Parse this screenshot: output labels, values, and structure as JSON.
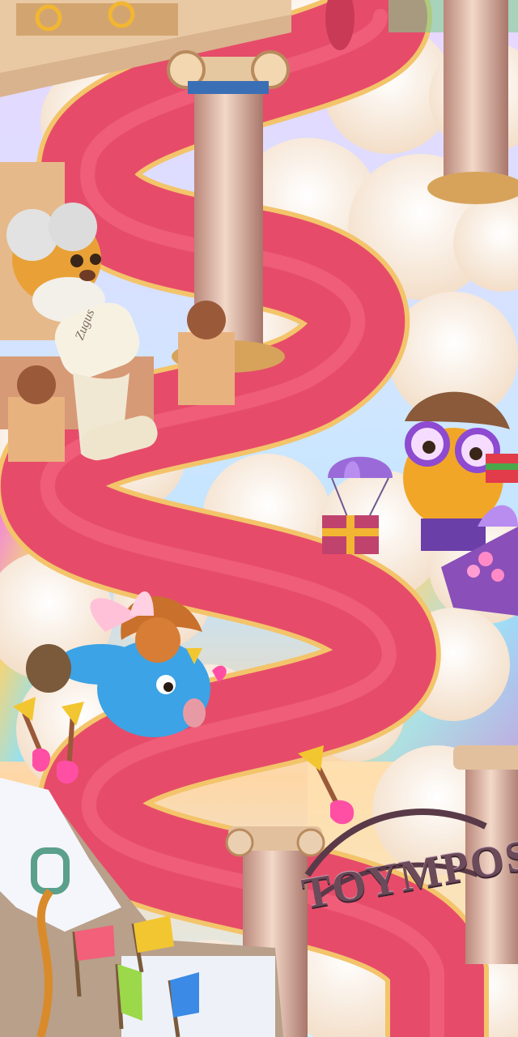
{
  "scene": {
    "sign_text": "TOYMPOS",
    "scroll_text": "Zugus"
  },
  "colors": {
    "carpet": "#e64c69",
    "carpet_trim": "#f3c46a",
    "cloud": "#fff6e8",
    "column": "#e8c6b4",
    "gold": "#f2b632"
  },
  "icons": [
    "clouds",
    "marble-columns",
    "throne",
    "lion-character",
    "scroll",
    "parachute-gift",
    "owl-character",
    "flower-basket",
    "cupid-character",
    "golden-arrows",
    "snowy-mountain",
    "flags",
    "rope-carabiner",
    "olympos-gate"
  ]
}
